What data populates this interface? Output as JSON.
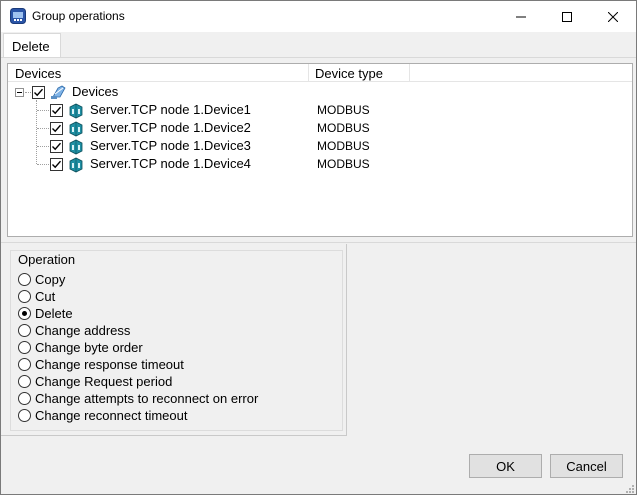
{
  "window": {
    "title": "Group operations",
    "icon": "group-operations-app-icon"
  },
  "tabs": [
    {
      "label": "Delete",
      "selected": true
    }
  ],
  "tree": {
    "columns": [
      "Devices",
      "Device type"
    ],
    "root": {
      "label": "Devices",
      "checked": true,
      "expanded": true,
      "icon": "devices-folder-icon"
    },
    "items": [
      {
        "label": "Server.TCP node 1.Device1",
        "type": "MODBUS",
        "checked": true,
        "icon": "device-icon"
      },
      {
        "label": "Server.TCP node 1.Device2",
        "type": "MODBUS",
        "checked": true,
        "icon": "device-icon"
      },
      {
        "label": "Server.TCP node 1.Device3",
        "type": "MODBUS",
        "checked": true,
        "icon": "device-icon"
      },
      {
        "label": "Server.TCP node 1.Device4",
        "type": "MODBUS",
        "checked": true,
        "icon": "device-icon"
      }
    ]
  },
  "operation": {
    "title": "Operation",
    "options": [
      {
        "label": "Copy",
        "checked": false
      },
      {
        "label": "Cut",
        "checked": false
      },
      {
        "label": "Delete",
        "checked": true
      },
      {
        "label": "Change address",
        "checked": false
      },
      {
        "label": "Change byte order",
        "checked": false
      },
      {
        "label": "Change response timeout",
        "checked": false
      },
      {
        "label": "Change Request period",
        "checked": false
      },
      {
        "label": "Change attempts to reconnect on error",
        "checked": false
      },
      {
        "label": "Change reconnect timeout",
        "checked": false
      }
    ]
  },
  "buttons": {
    "ok": "OK",
    "cancel": "Cancel"
  }
}
